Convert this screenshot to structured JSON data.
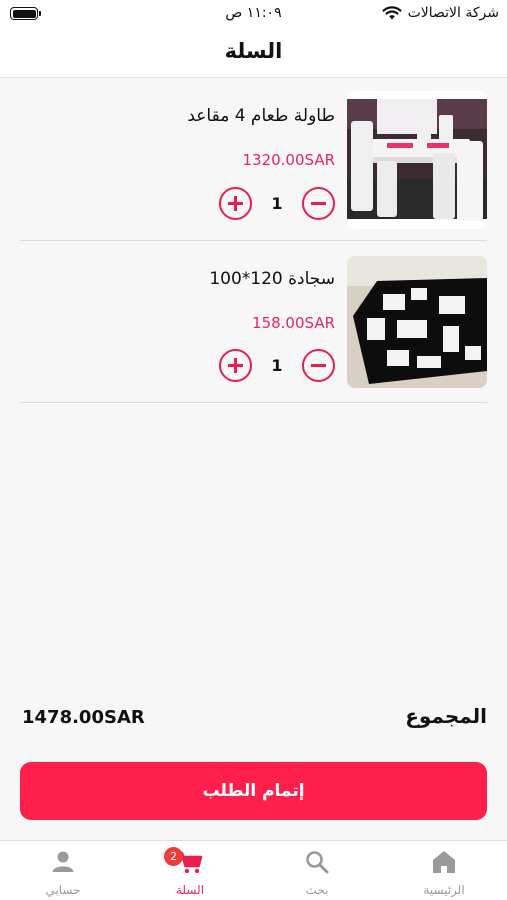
{
  "status_bar": {
    "carrier": "شركة الاتصالات",
    "time": "١١:٠٩ ص"
  },
  "header": {
    "title": "السلة"
  },
  "cart": {
    "items": [
      {
        "name": "طاولة طعام 4 مقاعد",
        "price": "1320.00SAR",
        "quantity": "1",
        "image": "dining-table-photo"
      },
      {
        "name": "سجادة 120*100",
        "price": "158.00SAR",
        "quantity": "1",
        "image": "rug-photo"
      }
    ]
  },
  "summary": {
    "total_label": "المجموع",
    "total_value": "1478.00SAR",
    "checkout_label": "إتمام الطلب"
  },
  "tab_bar": {
    "tabs": [
      {
        "label": "الرئيسية",
        "icon": "home-icon"
      },
      {
        "label": "بحث",
        "icon": "search-icon"
      },
      {
        "label": "السلة",
        "icon": "cart-icon",
        "badge": "2",
        "active": true
      },
      {
        "label": "حسابي",
        "icon": "user-icon"
      }
    ]
  },
  "colors": {
    "accent": "#fe1f4d",
    "price": "#e8265e",
    "inactive": "#9a9a9a"
  }
}
